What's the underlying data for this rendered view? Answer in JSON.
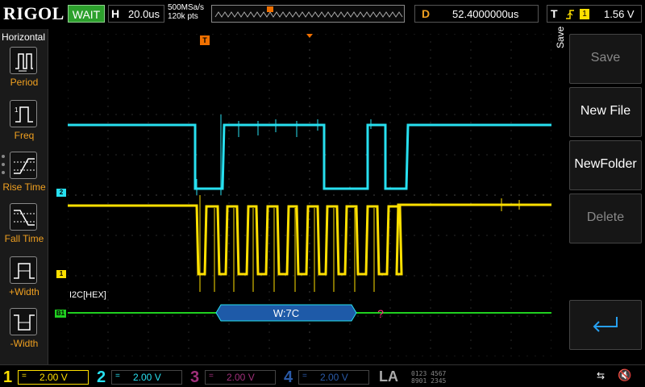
{
  "brand": "RIGOL",
  "trigger_status": "WAIT",
  "horizontal": {
    "label": "H",
    "timebase": "20.0us"
  },
  "acquisition": {
    "sample_rate": "500MSa/s",
    "memory_depth": "120k pts"
  },
  "delay": {
    "label": "D",
    "value": "52.4000000us"
  },
  "trigger": {
    "label": "T",
    "source": "1",
    "level": "1.56 V"
  },
  "left_menu": {
    "title": "Horizontal",
    "items": [
      {
        "label": "Period",
        "icon": "period-icon"
      },
      {
        "label": "Freq",
        "icon": "freq-icon"
      },
      {
        "label": "Rise Time",
        "icon": "rise-time-icon"
      },
      {
        "label": "Fall Time",
        "icon": "fall-time-icon"
      },
      {
        "label": "+Width",
        "icon": "positive-width-icon"
      },
      {
        "label": "-Width",
        "icon": "negative-width-icon"
      }
    ]
  },
  "right_menu": {
    "title": "Save",
    "buttons": [
      {
        "label": "Save",
        "enabled": false
      },
      {
        "label": "New File",
        "enabled": true
      },
      {
        "label": "NewFolder",
        "enabled": true
      },
      {
        "label": "Delete",
        "enabled": false
      }
    ],
    "back_icon": "return-arrow-icon"
  },
  "markers": {
    "ch2": "2",
    "ch1": "1",
    "bus": "B1",
    "trigger_pos": "T",
    "trigger_level": "T"
  },
  "decode": {
    "label": "I2C[HEX]",
    "packet": "W:7C",
    "error": "?"
  },
  "channels": [
    {
      "num": "1",
      "scale": "2.00 V",
      "color": "#ffe000"
    },
    {
      "num": "2",
      "scale": "2.00 V",
      "color": "#27e0f0"
    },
    {
      "num": "3",
      "scale": "2.00 V",
      "color": "#a0307a"
    },
    {
      "num": "4",
      "scale": "2.00 V",
      "color": "#2a5aa8"
    }
  ],
  "la": {
    "label": "LA",
    "row1": "0123 4567",
    "row2": "8901 2345"
  },
  "colors": {
    "ch1": "#ffe000",
    "ch2": "#27e0f0",
    "bus": "#20d020",
    "decode_fill": "#1e5aa8",
    "accent": "#f07000"
  }
}
